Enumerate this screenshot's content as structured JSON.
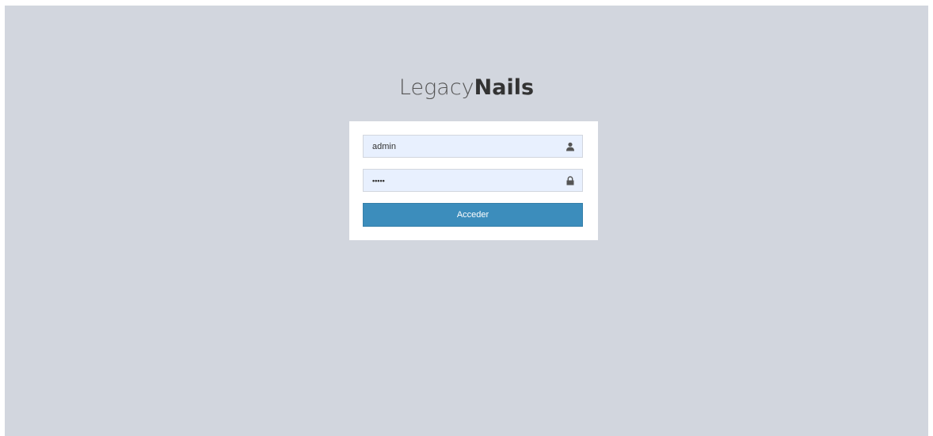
{
  "logo": {
    "light": "Legacy",
    "bold": "Nails"
  },
  "login": {
    "username_value": "admin",
    "password_value": "•••••",
    "username_icon": "user-icon",
    "password_icon": "lock-icon",
    "submit_label": "Acceder"
  },
  "colors": {
    "background": "#d2d6de",
    "button": "#3c8dbc",
    "input_fill": "#e8f0fe"
  }
}
